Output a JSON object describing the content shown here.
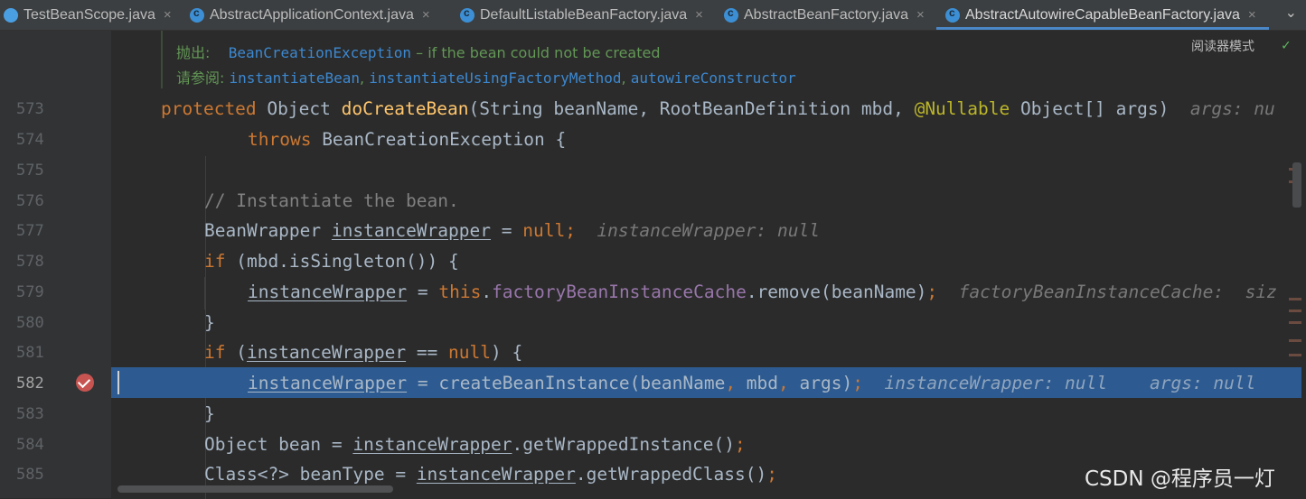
{
  "tabs": [
    {
      "label": "TestBeanScope.java",
      "icon": "java-test-class-icon"
    },
    {
      "label": "AbstractApplicationContext.java",
      "icon": "java-class-icon"
    },
    {
      "label": "DefaultListableBeanFactory.java",
      "icon": "java-class-icon"
    },
    {
      "label": "AbstractBeanFactory.java",
      "icon": "java-class-icon"
    },
    {
      "label": "AbstractAutowireCapableBeanFactory.java",
      "icon": "java-class-icon",
      "active": true
    }
  ],
  "doc": {
    "throws_label": "抛出:",
    "throws_exception": "BeanCreationException",
    "throws_desc": " – if the bean could not be created",
    "see_label": "请参阅:",
    "see_links": [
      "instantiateBean",
      "instantiateUsingFactoryMethod",
      "autowireConstructor"
    ],
    "separator": ","
  },
  "reader_mode": "阅读器模式",
  "line_numbers": [
    "573",
    "574",
    "575",
    "576",
    "577",
    "578",
    "579",
    "580",
    "581",
    "582",
    "583",
    "584",
    "585"
  ],
  "code": {
    "l573": {
      "kw": "protected",
      "type": " Object ",
      "fn": "doCreateBean",
      "p1": "(String beanName, RootBeanDefinition mbd, ",
      "ann": "@Nullable",
      "p2": " Object[] args)",
      "hint": "args: nu"
    },
    "l574": {
      "kw": "throws",
      "rest": " BeanCreationException {"
    },
    "l576": {
      "comment": "// Instantiate the bean."
    },
    "l577": {
      "type": "BeanWrapper ",
      "var": "instanceWrapper",
      "eq": " = ",
      "kw": "null",
      "semi": ";",
      "hint": "instanceWrapper: null"
    },
    "l578": {
      "kw": "if",
      "rest": " (mbd.isSingleton()) {"
    },
    "l579": {
      "var": "instanceWrapper",
      "eq": " = ",
      "kw": "this",
      "dot": ".",
      "field": "factoryBeanInstanceCache",
      "rest": ".remove(beanName)",
      "semi": ";",
      "hint": "factoryBeanInstanceCache:  siz"
    },
    "l580": {
      "rest": "}"
    },
    "l581": {
      "kw": "if",
      "p1": " (",
      "var": "instanceWrapper",
      "p2": " == ",
      "kw2": "null",
      "p3": ") {"
    },
    "l582": {
      "var": "instanceWrapper",
      "rest": " = createBeanInstance(beanName",
      "c1": ",",
      "mid1": " mbd",
      "c2": ",",
      "mid2": " args)",
      "semi": ";",
      "hint1": "instanceWrapper: null",
      "hint2": "args: null"
    },
    "l583": {
      "rest": "}"
    },
    "l584": {
      "p1": "Object bean = ",
      "var": "instanceWrapper",
      "p2": ".getWrappedInstance()",
      "semi": ";"
    },
    "l585": {
      "p1": "Class<?> beanType = ",
      "var": "instanceWrapper",
      "p2": ".getWrappedClass()",
      "semi": ";"
    }
  },
  "watermark": "CSDN @程序员一灯",
  "colors": {
    "background": "#2b2b2b",
    "keyword": "#cc7832",
    "function": "#ffc66d",
    "field": "#9876aa",
    "highlight": "#2d5b91"
  }
}
